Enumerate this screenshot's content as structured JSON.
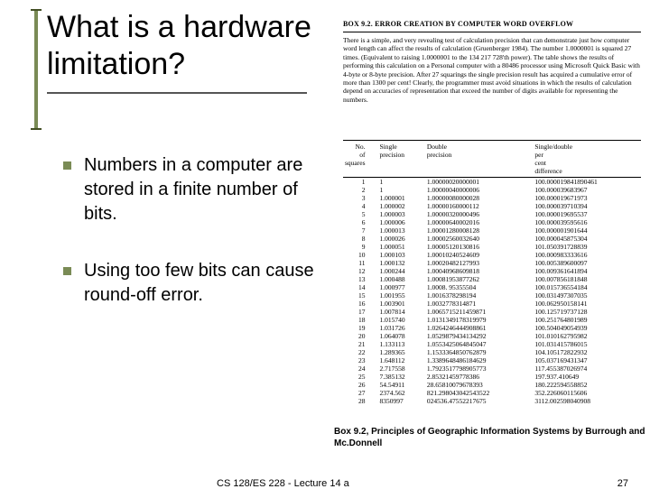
{
  "title": "What is a hardware limitation?",
  "bullets": [
    "Numbers in a computer are stored in a finite number of bits.",
    "Using too few bits can cause round-off error."
  ],
  "box": {
    "heading": "BOX 9.2. ERROR CREATION BY COMPUTER WORD OVERFLOW",
    "paragraph": "There is a simple, and very revealing test of calculation precision that can demonstrate just how computer word length can affect the results of calculation (Gruenberger 1984). The number 1.0000001 is squared 27 times. (Equivalent to raising 1.0000001 to the 134 217 728'th power). The table shows the results of performing this calculation on a Personal computer with a 80486 processor using Microsoft Quick Basic with 4-byte or 8-byte precision. After 27 squarings the single precision result has acquired a cumulative error of more than 1300 per cent! Clearly, the programmer must avoid situations in which the results of calculation depend on accuracies of representation that exceed the number of digits available for representing the numbers."
  },
  "table": {
    "headers": [
      "No. of squares",
      "Single precision",
      "Double precision",
      "Single/double per cent difference"
    ],
    "rows": [
      [
        "1",
        "1",
        "1.00000020000001",
        "100.000019841890461"
      ],
      [
        "2",
        "1",
        "1.00000040000006",
        "100.000039683967"
      ],
      [
        "3",
        "1.000001",
        "1.00000080000028",
        "100.000019671973"
      ],
      [
        "4",
        "1.000002",
        "1.00000160000112",
        "100.000039710394"
      ],
      [
        "5",
        "1.000003",
        "1.00000320000496",
        "100.000019695537"
      ],
      [
        "6",
        "1.000006",
        "1.00000640002016",
        "100.000039595616"
      ],
      [
        "7",
        "1.000013",
        "1.00001280008128",
        "100.000001901644"
      ],
      [
        "8",
        "1.000026",
        "1.00002560032640",
        "100.000045875304"
      ],
      [
        "9",
        "1.000051",
        "1.00005120130816",
        "101.050391728839"
      ],
      [
        "10",
        "1.000103",
        "1.00010240524609",
        "100.000983333616"
      ],
      [
        "11",
        "1.000132",
        "1.00020482127993",
        "100.005389600097"
      ],
      [
        "12",
        "1.000244",
        "1.00040968609818",
        "100.009361641894"
      ],
      [
        "13",
        "1.000488",
        "1.00081953877262",
        "100.007856181848"
      ],
      [
        "14",
        "1.000977",
        "1.0008. 95355504",
        "100.015736554184"
      ],
      [
        "15",
        "1.001955",
        "1.0016378298194",
        "100.031497307035"
      ],
      [
        "16",
        "1.003901",
        "1.0032778314871",
        "100.062950158141"
      ],
      [
        "17",
        "1.007814",
        "1.0065715211459871",
        "100.125719737128"
      ],
      [
        "18",
        "1.015740",
        "1.0131349178319979",
        "100.251764801989"
      ],
      [
        "19",
        "1.031726",
        "1.0264246444908861",
        "100.504049054939"
      ],
      [
        "20",
        "1.064078",
        "1.0529879434134292",
        "101.010162795982"
      ],
      [
        "21",
        "1.133113",
        "1.0553425064845047",
        "101.031415786015"
      ],
      [
        "22",
        "1.289365",
        "1.1533364850762879",
        "104.105172822932"
      ],
      [
        "23",
        "1.648112",
        "1.3389648486184629",
        "105.037169431347"
      ],
      [
        "24",
        "2.717558",
        "1.7923517798905773",
        "117.455387026974"
      ],
      [
        "25",
        "7.385132",
        "2.85321459778386",
        "197.937.410649"
      ],
      [
        "26",
        "54.54911",
        "28.65810079678393",
        "180.222594558852"
      ],
      [
        "27",
        "2374.562",
        "821.298043042543522",
        "352.226060115606"
      ],
      [
        "28",
        "8350997",
        "024536.47552217675",
        "3112.002598040908"
      ]
    ]
  },
  "caption": "Box 9.2, Principles of Geographic Information Systems by Burrough and Mc.Donnell",
  "footer": {
    "lecture": "CS 128/ES 228 - Lecture 14 a",
    "page": "27"
  }
}
